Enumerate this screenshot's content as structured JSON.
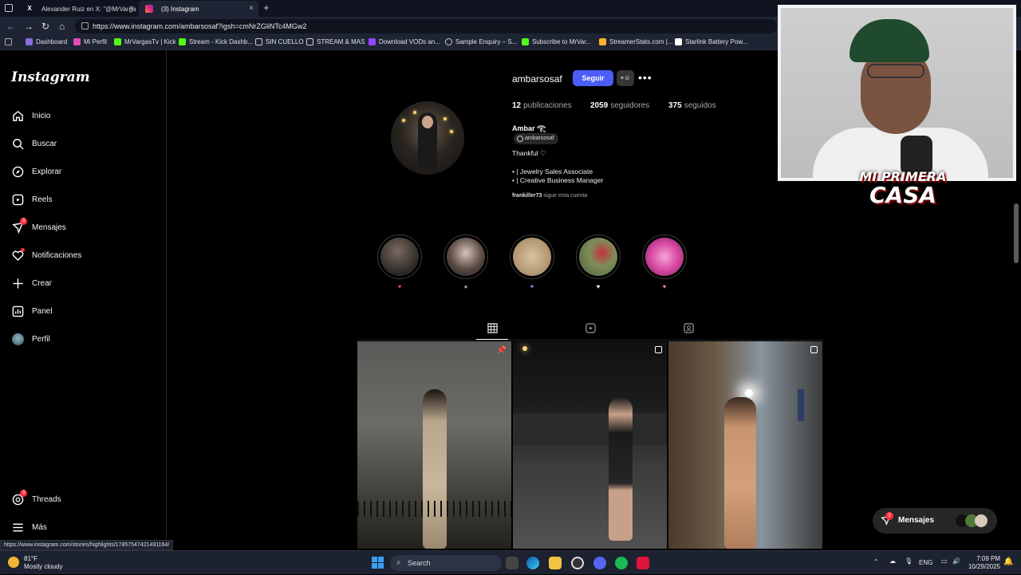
{
  "browser": {
    "tabs": [
      {
        "title": "Alexander Ruiz en X: \"@MrVarga"
      },
      {
        "title": "(3) Instagram"
      }
    ],
    "url": "https://www.instagram.com/ambarsosaf?igsh=cmNrZGliNTc4MGw2",
    "bookmarks": [
      "Dashboard",
      "Mi Perfil",
      "MrVargasTv | Kick",
      "Stream - Kick Dashb...",
      "SIN CUELLO",
      "STREAM & MAS",
      "Download VODs an...",
      "Sample Enquiry – S...",
      "Subscribe to MrVar...",
      "StreamerStats.com |...",
      "Starlink Battery Pow..."
    ],
    "status_url": "https://www.instagram.com/stories/highlights/17857547421491164/"
  },
  "sidebar": {
    "logo": "Instagram",
    "items": [
      {
        "label": "Inicio",
        "icon": "home-icon"
      },
      {
        "label": "Buscar",
        "icon": "search-icon"
      },
      {
        "label": "Explorar",
        "icon": "compass-icon"
      },
      {
        "label": "Reels",
        "icon": "reels-icon"
      },
      {
        "label": "Mensajes",
        "icon": "messenger-icon",
        "badge": "3"
      },
      {
        "label": "Notificaciones",
        "icon": "heart-icon"
      },
      {
        "label": "Crear",
        "icon": "plus-icon"
      },
      {
        "label": "Panel",
        "icon": "dashboard-icon"
      },
      {
        "label": "Perfil",
        "icon": "avatar-icon"
      }
    ],
    "bottom": [
      {
        "label": "Threads",
        "icon": "threads-icon",
        "badge": "3"
      },
      {
        "label": "Más",
        "icon": "menu-icon"
      }
    ]
  },
  "profile": {
    "username": "ambarsosaf",
    "follow_label": "Seguir",
    "stats": [
      {
        "value": "12",
        "label": "publicaciones"
      },
      {
        "value": "2059",
        "label": "seguidores"
      },
      {
        "value": "375",
        "label": "seguidos"
      }
    ],
    "full_name": "Ambar 𓂀",
    "threads_handle": "ambarsosaf",
    "bio_lines": [
      "Thankful ♡",
      "• | Jewelry Sales Associate",
      "• | Creative Business Manager"
    ],
    "followed_by_user": "frankiller73",
    "followed_by_text": " sigue esta cuenta"
  },
  "highlights": [
    {
      "label": "♥",
      "color": "#e8416f"
    },
    {
      "label": "●",
      "color": "#9a9a9a"
    },
    {
      "label": "✦",
      "color": "#b58cf0"
    },
    {
      "label": "♥",
      "color": "#f0f0f0"
    },
    {
      "label": "♥",
      "color": "#ff79c6"
    }
  ],
  "messages_pill": {
    "label": "Mensajes",
    "badge": "3"
  },
  "overlay": {
    "line1": "MI PRIMERA",
    "line2": "CASA"
  },
  "taskbar": {
    "temp": "81°F",
    "weather": "Mostly cloudy",
    "search": "Search",
    "lang": "ENG",
    "time": "7:09 PM",
    "date": "10/29/2025"
  },
  "colors": {
    "accent": "#4a5df9",
    "badge": "#ff3040",
    "bg": "#000000"
  }
}
